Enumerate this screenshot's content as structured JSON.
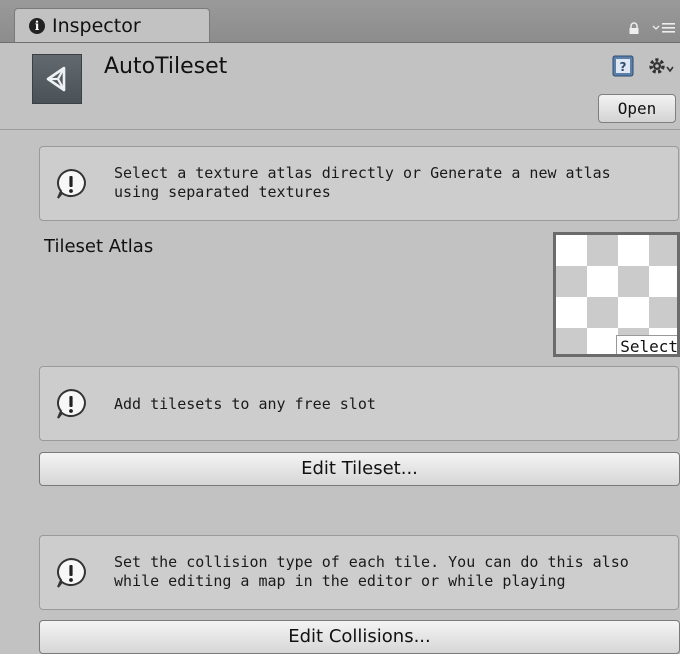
{
  "tab": {
    "title": "Inspector",
    "icon": "info-icon",
    "lock_icon": "lock-icon",
    "menu_icon": "tab-menu-icon"
  },
  "header": {
    "title": "AutoTileset",
    "asset_icon": "unity-asset-icon",
    "help_icon": "help-book-icon",
    "settings_icon": "gear-icon",
    "open_label": "Open"
  },
  "help_boxes": [
    {
      "text": "Select a texture atlas directly or Generate a new atlas\nusing separated textures",
      "icon": "warning-icon"
    },
    {
      "text": "Add tilesets to any free slot",
      "icon": "warning-icon"
    },
    {
      "text": "Set the collision type of each tile. You can do this also\nwhile editing a map in the editor or while playing",
      "icon": "warning-icon"
    }
  ],
  "tileset_atlas": {
    "label": "Tileset Atlas",
    "select_label": "Select"
  },
  "buttons": {
    "edit_tileset": "Edit Tileset...",
    "edit_collisions": "Edit Collisions..."
  },
  "colors": {
    "panel_bg": "#c2c2c2",
    "tab_bar_bg": "#8f8f8f",
    "helpbox_bg": "#cdcdcd",
    "button_bg": "#e6e6e6"
  }
}
